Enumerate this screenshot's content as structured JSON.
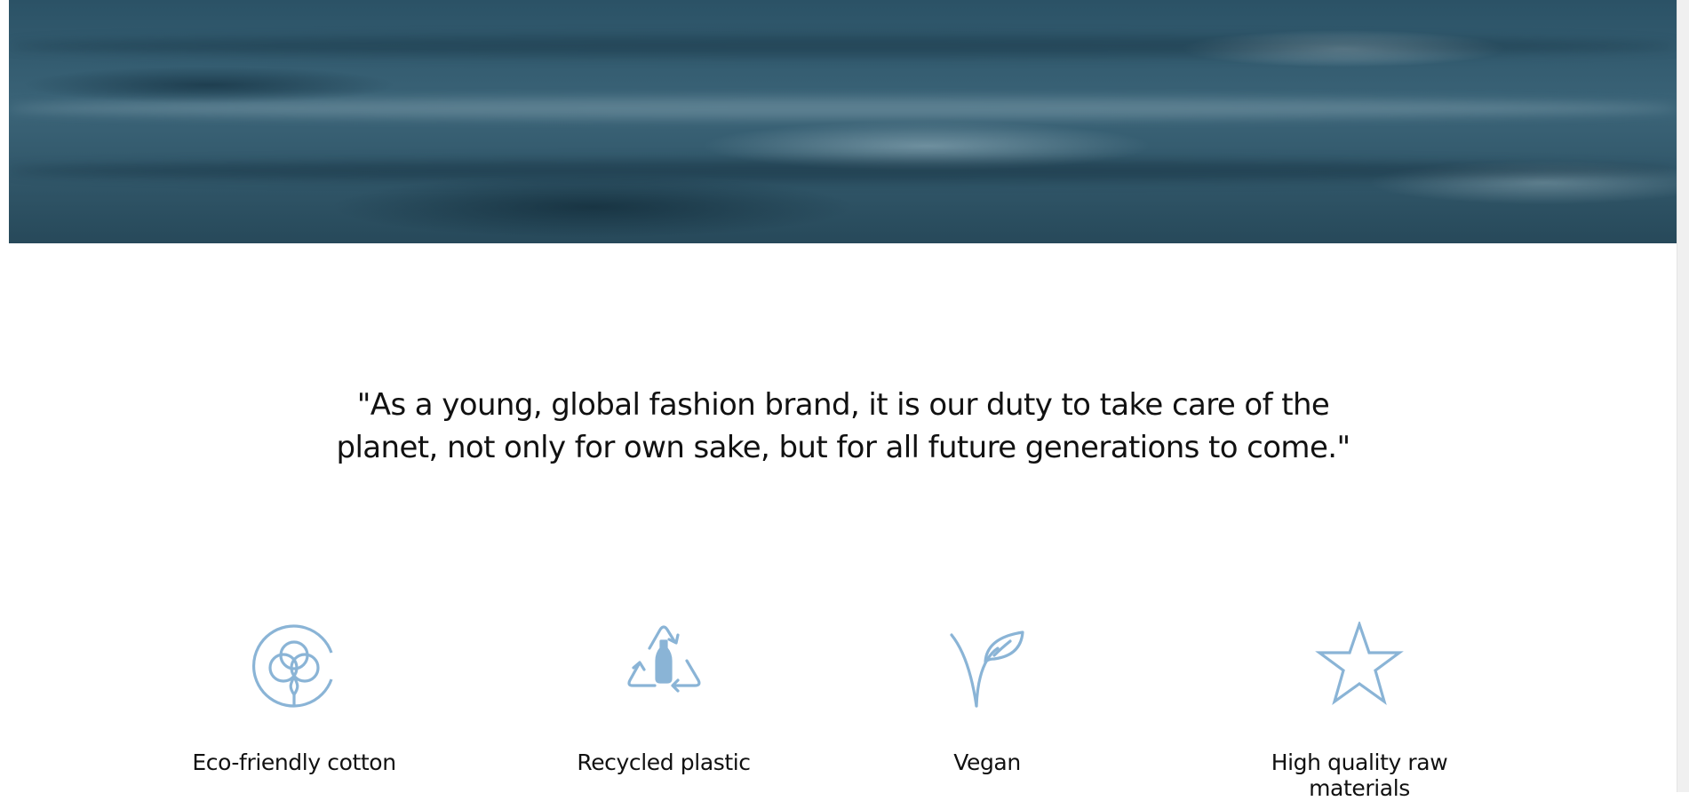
{
  "quote": {
    "line1": "\"As a young, global fashion brand, it is our duty to take care of the",
    "line2": "planet, not only for own sake, but for all future generations to come.\""
  },
  "features": [
    {
      "label": "Eco-friendly cotton",
      "icon": "cotton-icon"
    },
    {
      "label": "Recycled plastic",
      "icon": "recycle-bottle-icon"
    },
    {
      "label": "Vegan",
      "icon": "sprout-icon"
    },
    {
      "label": "High quality raw materials",
      "icon": "star-icon"
    }
  ],
  "colors": {
    "icon_accent": "#8ab4d6",
    "text": "#111111"
  }
}
